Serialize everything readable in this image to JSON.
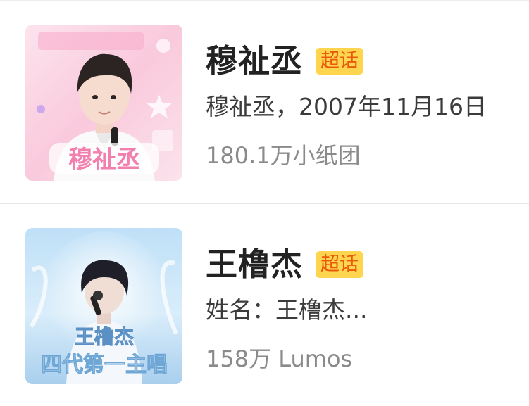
{
  "results": [
    {
      "name": "穆祉丞",
      "badge": "超话",
      "description": "穆祉丞，2007年11月16日",
      "fans": "180.1万小纸团",
      "avatar_icon": "pink-idol-poster",
      "avatar_caption": "穆祉丞"
    },
    {
      "name": "王橹杰",
      "badge": "超话",
      "description": "姓名：王橹杰...",
      "fans": "158万 Lumos",
      "avatar_icon": "blue-singer-poster",
      "avatar_caption": "王橹杰",
      "avatar_subcaption": "四代第一主唱"
    }
  ],
  "colors": {
    "badge_bg": "#ffd54f",
    "badge_text": "#e8590c",
    "name": "#222222",
    "desc": "#3b3b3b",
    "fans": "#8a8a8a"
  }
}
